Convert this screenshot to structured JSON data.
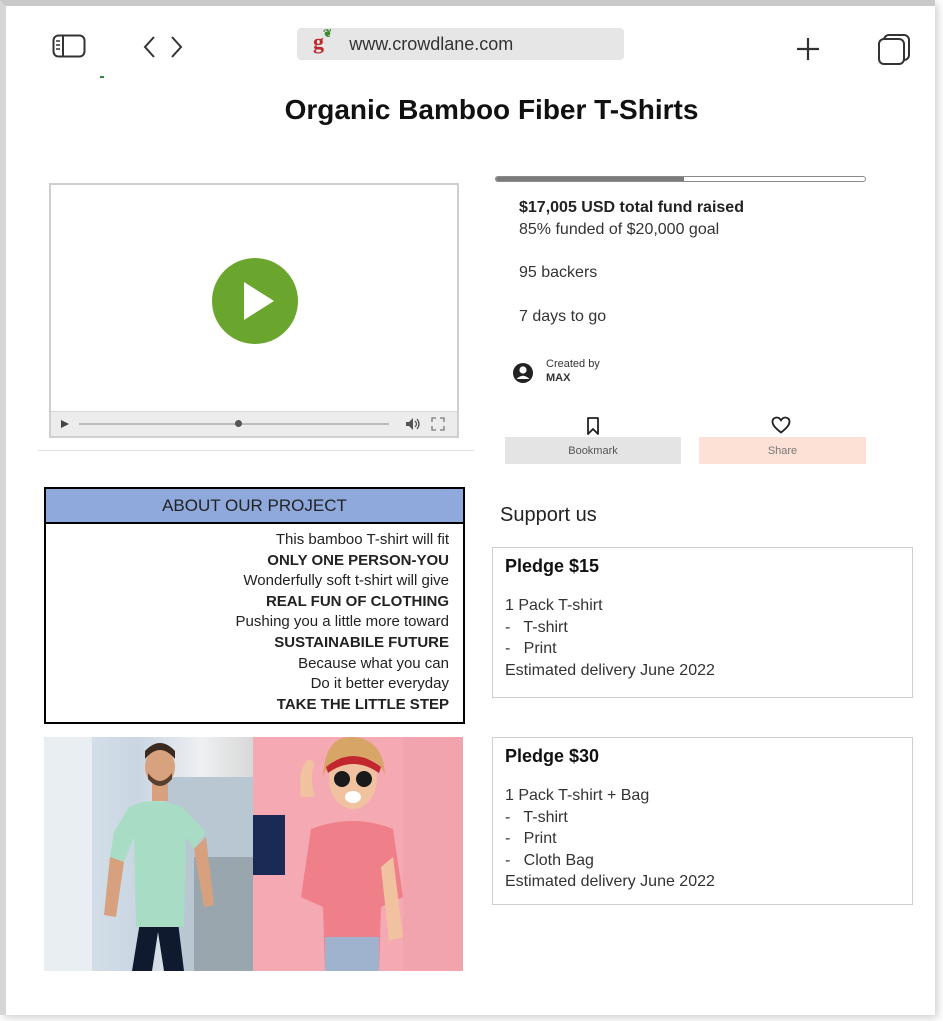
{
  "browser": {
    "url": "www.crowdlane.com",
    "favicon_letter": "g"
  },
  "project": {
    "title": "Organic Bamboo Fiber T-Shirts"
  },
  "funding": {
    "progress_percent": 85,
    "total_raised": "$17,005 USD total fund raised",
    "funded_text": "85% funded of $20,000 goal",
    "backers": "95 backers",
    "days_left": "7 days to go",
    "created_by_label": "Created by",
    "creator": "MAX"
  },
  "actions": {
    "bookmark_label": "Bookmark",
    "share_label": "Share"
  },
  "about": {
    "heading": "ABOUT OUR PROJECT",
    "lines": [
      {
        "text": "This bamboo T-shirt will fit",
        "bold": false
      },
      {
        "text": "ONLY ONE PERSON-YOU",
        "bold": true
      },
      {
        "text": "Wonderfully soft t-shirt will give",
        "bold": false
      },
      {
        "text": "REAL FUN OF CLOTHING",
        "bold": true
      },
      {
        "text": "Pushing you a little more toward",
        "bold": false
      },
      {
        "text": "SUSTAINABILE FUTURE",
        "bold": true
      },
      {
        "text": "Because what you can",
        "bold": false
      },
      {
        "text": "Do it better everyday",
        "bold": false
      },
      {
        "text": "TAKE THE LITTLE STEP",
        "bold": true
      }
    ]
  },
  "support": {
    "heading": "Support us",
    "pledges": [
      {
        "title": "Pledge $15",
        "lines": [
          "1 Pack T-shirt",
          "-   T-shirt",
          "-   Print",
          "Estimated delivery June 2022"
        ]
      },
      {
        "title": "Pledge $30",
        "lines": [
          "1 Pack T-shirt + Bag",
          "-   T-shirt",
          "-   Print",
          "-   Cloth Bag",
          "Estimated delivery June 2022"
        ]
      }
    ]
  },
  "colors": {
    "play_button": "#6aa62d",
    "about_header": "#8fa9dc",
    "share_button": "#fde0d6",
    "bookmark_button": "#e4e4e4"
  }
}
